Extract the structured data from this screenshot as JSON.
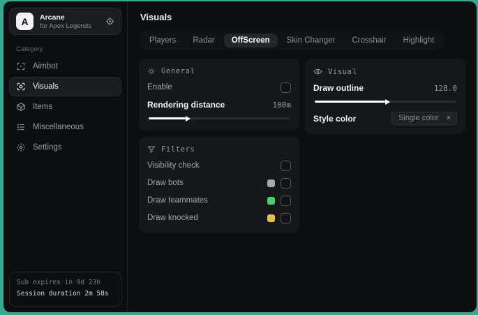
{
  "accent_border_color": "#38a98e",
  "sidebar": {
    "brand": {
      "logo_letter": "A",
      "title": "Arcane",
      "subtitle": "for Apex Legends"
    },
    "category_label": "Category",
    "items": [
      {
        "label": "Aimbot",
        "icon": "aim-scan-icon",
        "active": false
      },
      {
        "label": "Visuals",
        "icon": "eye-scan-icon",
        "active": true
      },
      {
        "label": "Items",
        "icon": "box-icon",
        "active": false
      },
      {
        "label": "Miscellaneous",
        "icon": "list-icon",
        "active": false
      },
      {
        "label": "Settings",
        "icon": "gear-icon",
        "active": false
      }
    ],
    "footer": {
      "sub_expires": "Sub expires in 9d 23h",
      "session_duration": "Session duration 2m 58s"
    }
  },
  "main": {
    "title": "Visuals",
    "tabs": [
      {
        "label": "Players",
        "active": false
      },
      {
        "label": "Radar",
        "active": false
      },
      {
        "label": "OffScreen",
        "active": true
      },
      {
        "label": "Skin Changer",
        "active": false
      },
      {
        "label": "Crosshair",
        "active": false
      },
      {
        "label": "Highlight",
        "active": false
      }
    ],
    "panels": {
      "general": {
        "header": "General",
        "enable_label": "Enable",
        "enable_checked": false,
        "distance_label": "Rendering distance",
        "distance_value": "100m",
        "slider_fill": "26%"
      },
      "visual": {
        "header": "Visual",
        "outline_label": "Draw outline",
        "outline_value": "128.0",
        "slider_fill": "50%",
        "style_label": "Style color",
        "style_value": "Single color",
        "clear_glyph": "×"
      },
      "filters": {
        "header": "Filters",
        "rows": [
          {
            "label": "Visibility check",
            "swatch": null,
            "checked": false
          },
          {
            "label": "Draw bots",
            "swatch": "#a8a8a8",
            "checked": false
          },
          {
            "label": "Draw teammates",
            "swatch": "#45d463",
            "checked": false
          },
          {
            "label": "Draw knocked",
            "swatch": "#e2c24d",
            "checked": false
          }
        ]
      }
    }
  }
}
